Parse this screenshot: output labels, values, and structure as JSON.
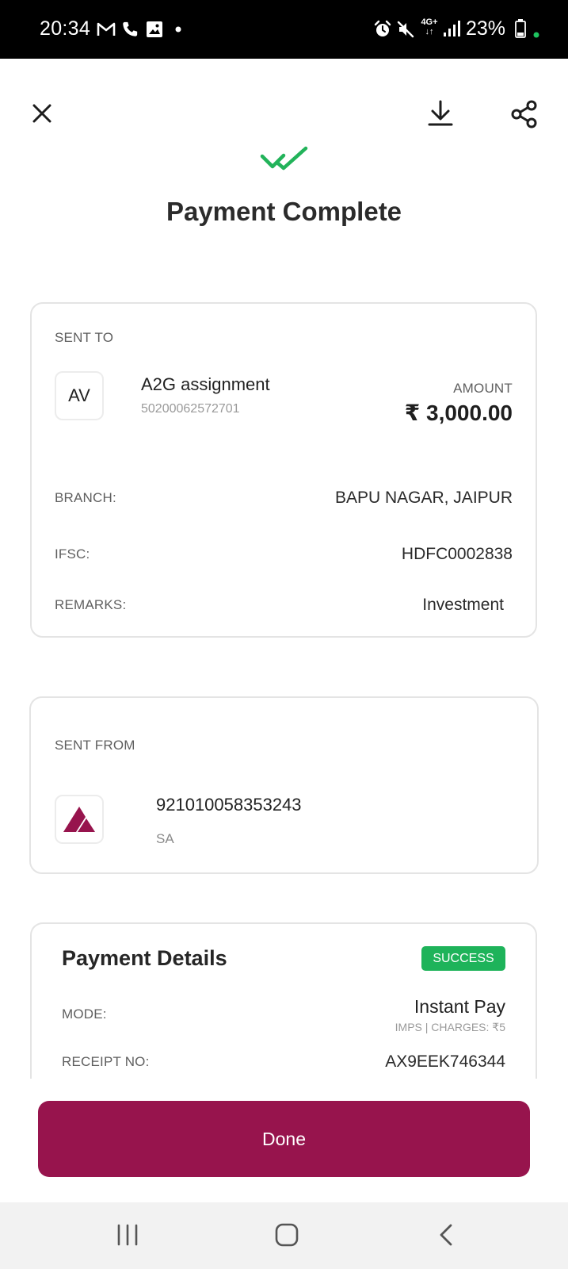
{
  "status_bar": {
    "time": "20:34",
    "network": "4G+",
    "battery": "23%"
  },
  "header": {
    "close_icon": "close-icon",
    "download_icon": "download-icon",
    "share_icon": "share-icon",
    "check_icon": "double-check-icon",
    "title": "Payment Complete"
  },
  "sent_to": {
    "heading": "SENT TO",
    "avatar_initials": "AV",
    "name": "A2G assignment",
    "account_number": "50200062572701",
    "amount_label": "AMOUNT",
    "amount_value": "₹ 3,000.00",
    "branch_label": "BRANCH:",
    "branch_value": "BAPU NAGAR, JAIPUR",
    "ifsc_label": "IFSC:",
    "ifsc_value": "HDFC0002838",
    "remarks_label": "REMARKS:",
    "remarks_value": "Investment"
  },
  "sent_from": {
    "heading": "SENT FROM",
    "bank_logo": "axis-bank-logo",
    "account_number": "921010058353243",
    "account_type": "SA"
  },
  "payment_details": {
    "title": "Payment Details",
    "status": "SUCCESS",
    "mode_label": "MODE:",
    "mode_value": "Instant Pay",
    "mode_sub": "IMPS | CHARGES: ₹5",
    "receipt_label": "RECEIPT NO:",
    "receipt_value": "AX9EEK746344"
  },
  "footer": {
    "done_label": "Done"
  },
  "colors": {
    "brand": "#97144d",
    "success": "#1eb35a",
    "check": "#22b35a"
  }
}
